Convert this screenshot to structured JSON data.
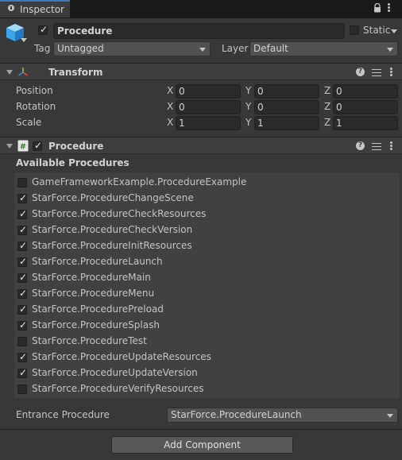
{
  "window": {
    "tab_label": "Inspector"
  },
  "gameobject": {
    "name": "Procedure",
    "active": true,
    "static_label": "Static",
    "static_checked": false,
    "tag_label": "Tag",
    "tag_value": "Untagged",
    "layer_label": "Layer",
    "layer_value": "Default"
  },
  "transform": {
    "title": "Transform",
    "rows": [
      {
        "label": "Position",
        "x": "0",
        "y": "0",
        "z": "0"
      },
      {
        "label": "Rotation",
        "x": "0",
        "y": "0",
        "z": "0"
      },
      {
        "label": "Scale",
        "x": "1",
        "y": "1",
        "z": "1"
      }
    ],
    "axis_labels": [
      "X",
      "Y",
      "Z"
    ]
  },
  "procedure_component": {
    "title": "Procedure",
    "enabled": true,
    "section_label": "Available Procedures",
    "procedures": [
      {
        "name": "GameFrameworkExample.ProcedureExample",
        "checked": false
      },
      {
        "name": "StarForce.ProcedureChangeScene",
        "checked": true
      },
      {
        "name": "StarForce.ProcedureCheckResources",
        "checked": true
      },
      {
        "name": "StarForce.ProcedureCheckVersion",
        "checked": true
      },
      {
        "name": "StarForce.ProcedureInitResources",
        "checked": true
      },
      {
        "name": "StarForce.ProcedureLaunch",
        "checked": true
      },
      {
        "name": "StarForce.ProcedureMain",
        "checked": true
      },
      {
        "name": "StarForce.ProcedureMenu",
        "checked": true
      },
      {
        "name": "StarForce.ProcedurePreload",
        "checked": true
      },
      {
        "name": "StarForce.ProcedureSplash",
        "checked": true
      },
      {
        "name": "StarForce.ProcedureTest",
        "checked": false
      },
      {
        "name": "StarForce.ProcedureUpdateResources",
        "checked": true
      },
      {
        "name": "StarForce.ProcedureUpdateVersion",
        "checked": true
      },
      {
        "name": "StarForce.ProcedureVerifyResources",
        "checked": false
      }
    ],
    "entrance_label": "Entrance Procedure",
    "entrance_value": "StarForce.ProcedureLaunch"
  },
  "footer": {
    "add_component_label": "Add Component"
  },
  "colors": {
    "accent": "#3a79bb",
    "background": "#383838",
    "header": "#3e3e3e",
    "field": "#2a2a2a"
  },
  "icons": [
    "inspector-icon",
    "lock-icon",
    "menu-icon",
    "cube-icon",
    "transform-icon",
    "script-icon",
    "help-icon",
    "preset-icon"
  ]
}
